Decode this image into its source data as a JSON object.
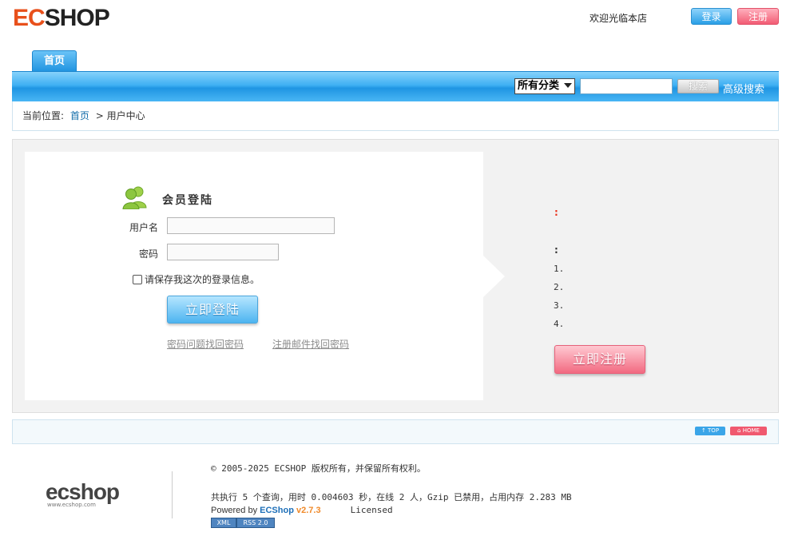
{
  "header": {
    "logo_ec": "EC",
    "logo_shop": "SHOP",
    "welcome": "欢迎光临本店",
    "login_label": "登录",
    "register_label": "注册"
  },
  "nav": {
    "home_tab": "首页",
    "category_select": "所有分类",
    "search_button": "搜索",
    "advanced_search": "高级搜索"
  },
  "breadcrumb": {
    "prefix": "当前位置:",
    "home": "首页",
    "separator": ">",
    "current": "用户中心"
  },
  "login": {
    "title": "会员登陆",
    "username_label": "用户名",
    "password_label": "密码",
    "remember_label": "请保存我这次的登录信息。",
    "submit_label": "立即登陆",
    "forgot_question_link": "密码问题找回密码",
    "forgot_email_link": "注册邮件找回密码"
  },
  "register": {
    "heading_colon": ":",
    "sub_colon": ":",
    "items": [
      "1.",
      "2.",
      "3.",
      "4."
    ],
    "register_button": "立即注册"
  },
  "footer": {
    "top_button": "↑ TOP",
    "home_button": "⌂ HOME",
    "logo_ec": "ec",
    "logo_shop": "shop",
    "logo_url": "www.ecshop.com",
    "copyright": "© 2005-2025 ECSHOP 版权所有，并保留所有权利。",
    "stats": "共执行 5 个查询，用时 0.004603 秒，在线 2 人，Gzip 已禁用，占用内存 2.283 MB",
    "powered_by": "Powered by",
    "powered_name": "ECShop",
    "powered_version": "v2.7.3",
    "licensed": "Licensed",
    "badge_xml": "XML",
    "badge_rss": "RSS 2.0"
  },
  "colors": {
    "nav_blue": "#1f95e3",
    "accent_orange": "#e8501b",
    "link_blue": "#0f6ba8",
    "register_pink": "#f26a81",
    "user_icon_green": "#8cc63f"
  }
}
